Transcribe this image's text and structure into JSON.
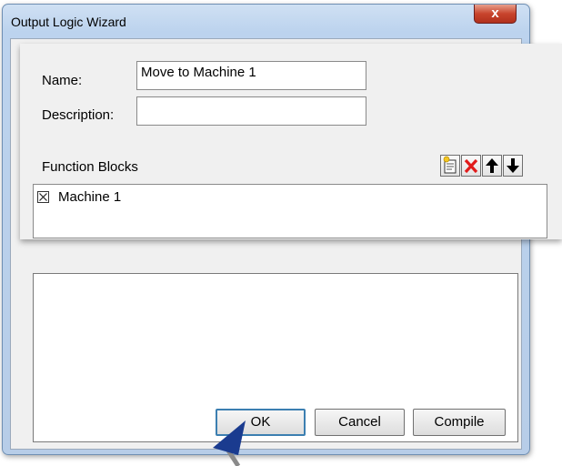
{
  "window": {
    "title": "Output Logic Wizard",
    "close_symbol": "x"
  },
  "form": {
    "name_label": "Name:",
    "name_value": "Move to Machine 1",
    "description_label": "Description:",
    "description_value": "",
    "function_blocks_label": "Function Blocks"
  },
  "toolbar": {
    "icons": [
      "new-block-icon",
      "delete-icon",
      "move-up-icon",
      "move-down-icon"
    ]
  },
  "function_blocks": [
    {
      "checked": true,
      "label": "Machine 1"
    }
  ],
  "buttons": {
    "ok": "OK",
    "cancel": "Cancel",
    "compile": "Compile"
  },
  "colors": {
    "delete_icon": "#e11b1b",
    "arrow_pointer": "#1a3b8f",
    "default_button_border": "#3c7fb1"
  }
}
